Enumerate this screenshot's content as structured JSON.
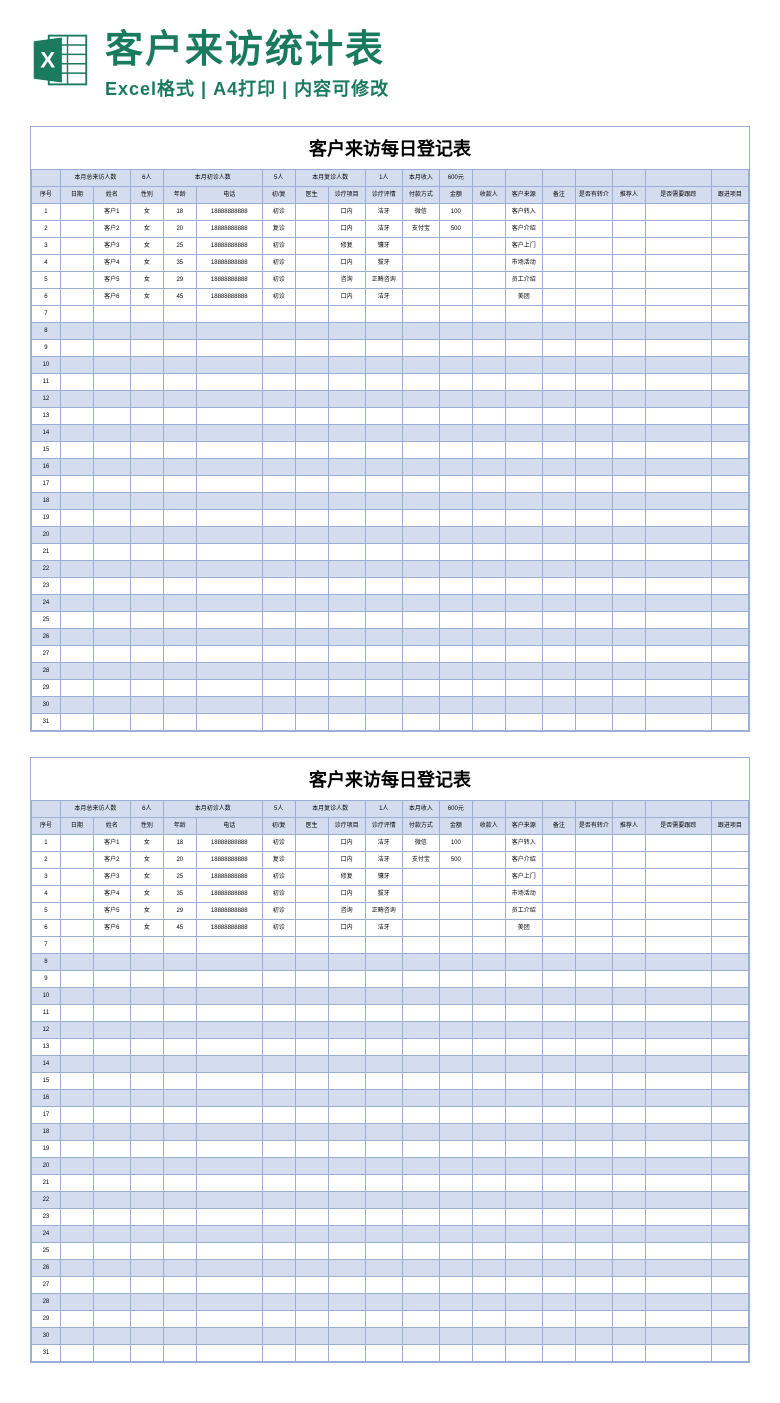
{
  "header": {
    "title": "客户来访统计表",
    "subtitle": "Excel格式 | A4打印 | 内容可修改"
  },
  "sheet_title": "客户来访每日登记表",
  "summary": {
    "labels": [
      "本月总来访人数",
      "6人",
      "本月初诊人数",
      "5人",
      "本月复诊人数",
      "1人",
      "本月收入",
      "600元"
    ],
    "blank": ""
  },
  "columns": [
    "序号",
    "日期",
    "姓名",
    "性别",
    "年龄",
    "电话",
    "初/复",
    "医生",
    "诊疗项目",
    "诊疗评情",
    "付款方式",
    "金额",
    "收款人",
    "客户来源",
    "备注",
    "是否有转介",
    "推荐人",
    "是否需要跟踪",
    "跟进项目"
  ],
  "rows": [
    {
      "idx": "1",
      "date": "",
      "name": "客户1",
      "sex": "女",
      "age": "18",
      "tel": "18888888888",
      "type": "初诊",
      "dr": "",
      "proj": "口内",
      "detail": "洁牙",
      "pay": "微信",
      "amt": "100",
      "cashier": "",
      "src": "客户转入",
      "memo": "",
      "ref": "",
      "refp": "",
      "follow": "",
      "fproj": ""
    },
    {
      "idx": "2",
      "date": "",
      "name": "客户2",
      "sex": "女",
      "age": "20",
      "tel": "18888888888",
      "type": "复诊",
      "dr": "",
      "proj": "口内",
      "detail": "洁牙",
      "pay": "支付宝",
      "amt": "500",
      "cashier": "",
      "src": "客户介绍",
      "memo": "",
      "ref": "",
      "refp": "",
      "follow": "",
      "fproj": ""
    },
    {
      "idx": "3",
      "date": "",
      "name": "客户3",
      "sex": "女",
      "age": "25",
      "tel": "18888888888",
      "type": "初诊",
      "dr": "",
      "proj": "修复",
      "detail": "镶牙",
      "pay": "",
      "amt": "",
      "cashier": "",
      "src": "客户上门",
      "memo": "",
      "ref": "",
      "refp": "",
      "follow": "",
      "fproj": ""
    },
    {
      "idx": "4",
      "date": "",
      "name": "客户4",
      "sex": "女",
      "age": "35",
      "tel": "18888888888",
      "type": "初诊",
      "dr": "",
      "proj": "口内",
      "detail": "拔牙",
      "pay": "",
      "amt": "",
      "cashier": "",
      "src": "市场活动",
      "memo": "",
      "ref": "",
      "refp": "",
      "follow": "",
      "fproj": ""
    },
    {
      "idx": "5",
      "date": "",
      "name": "客户5",
      "sex": "女",
      "age": "29",
      "tel": "18888888888",
      "type": "初诊",
      "dr": "",
      "proj": "咨询",
      "detail": "正畸咨询",
      "pay": "",
      "amt": "",
      "cashier": "",
      "src": "员工介绍",
      "memo": "",
      "ref": "",
      "refp": "",
      "follow": "",
      "fproj": ""
    },
    {
      "idx": "6",
      "date": "",
      "name": "客户6",
      "sex": "女",
      "age": "45",
      "tel": "18888888888",
      "type": "初诊",
      "dr": "",
      "proj": "口内",
      "detail": "洁牙",
      "pay": "",
      "amt": "",
      "cashier": "",
      "src": "美团",
      "memo": "",
      "ref": "",
      "refp": "",
      "follow": "",
      "fproj": ""
    }
  ],
  "empty_count": 25
}
